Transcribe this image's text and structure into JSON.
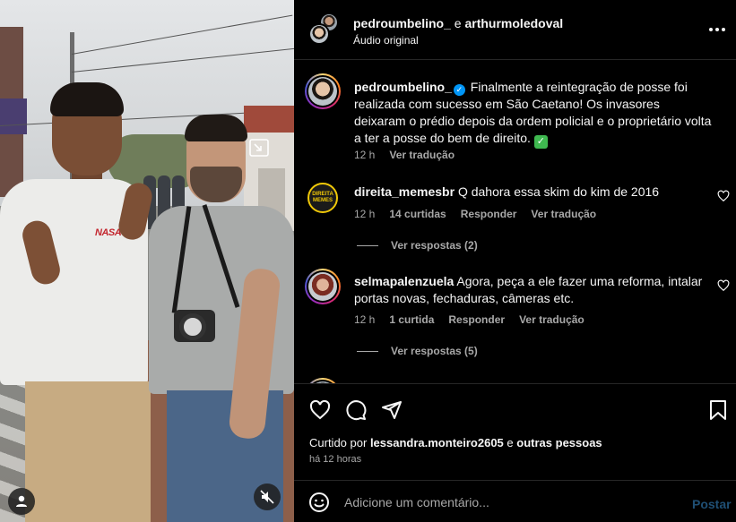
{
  "post_header": {
    "username_primary": "pedroumbelino_",
    "separator": "e",
    "username_collab": "arthurmoledoval",
    "audio_label": "Áudio original"
  },
  "caption": {
    "username": "pedroumbelino_",
    "text": "Finalmente a reintegração de posse foi realizada com sucesso em São Caetano! Os invasores deixaram o prédio depois da ordem policial e o proprietário volta a ter a posse do bem de direito.",
    "time": "12 h",
    "see_translation": "Ver tradução"
  },
  "comments": [
    {
      "username": "direita_memesbr",
      "text": "Q dahora essa skim do kim de 2016",
      "time": "12 h",
      "likes": "14 curtidas",
      "reply_label": "Responder",
      "translation_label": "Ver tradução",
      "view_replies": "Ver respostas (2)",
      "avatar_text": [
        "DIREITA",
        "MEMES"
      ]
    },
    {
      "username": "selmapalenzuela",
      "text": "Agora, peça a ele fazer uma reforma, intalar portas novas, fechaduras, câmeras etc.",
      "time": "12 h",
      "likes": "1 curtida",
      "reply_label": "Responder",
      "translation_label": "Ver tradução",
      "view_replies": "Ver respostas (5)"
    }
  ],
  "media": {
    "shirt_logo": "NASA"
  },
  "actions": {
    "liked_prefix": "Curtido por",
    "liked_user": "lessandra.monteiro2605",
    "liked_and": "e",
    "liked_others": "outras pessoas",
    "posted_ago": "há 12 horas"
  },
  "composer": {
    "placeholder": "Adicione um comentário...",
    "post_label": "Postar"
  },
  "icons": {
    "header_more": "more-horizontal-icon",
    "like": "heart-icon",
    "comment": "comment-icon",
    "share": "share-icon",
    "save": "bookmark-icon",
    "emoji": "emoji-icon",
    "mute": "muted-speaker-icon",
    "tags": "user-tag-icon",
    "pip": "picture-in-picture-icon"
  }
}
